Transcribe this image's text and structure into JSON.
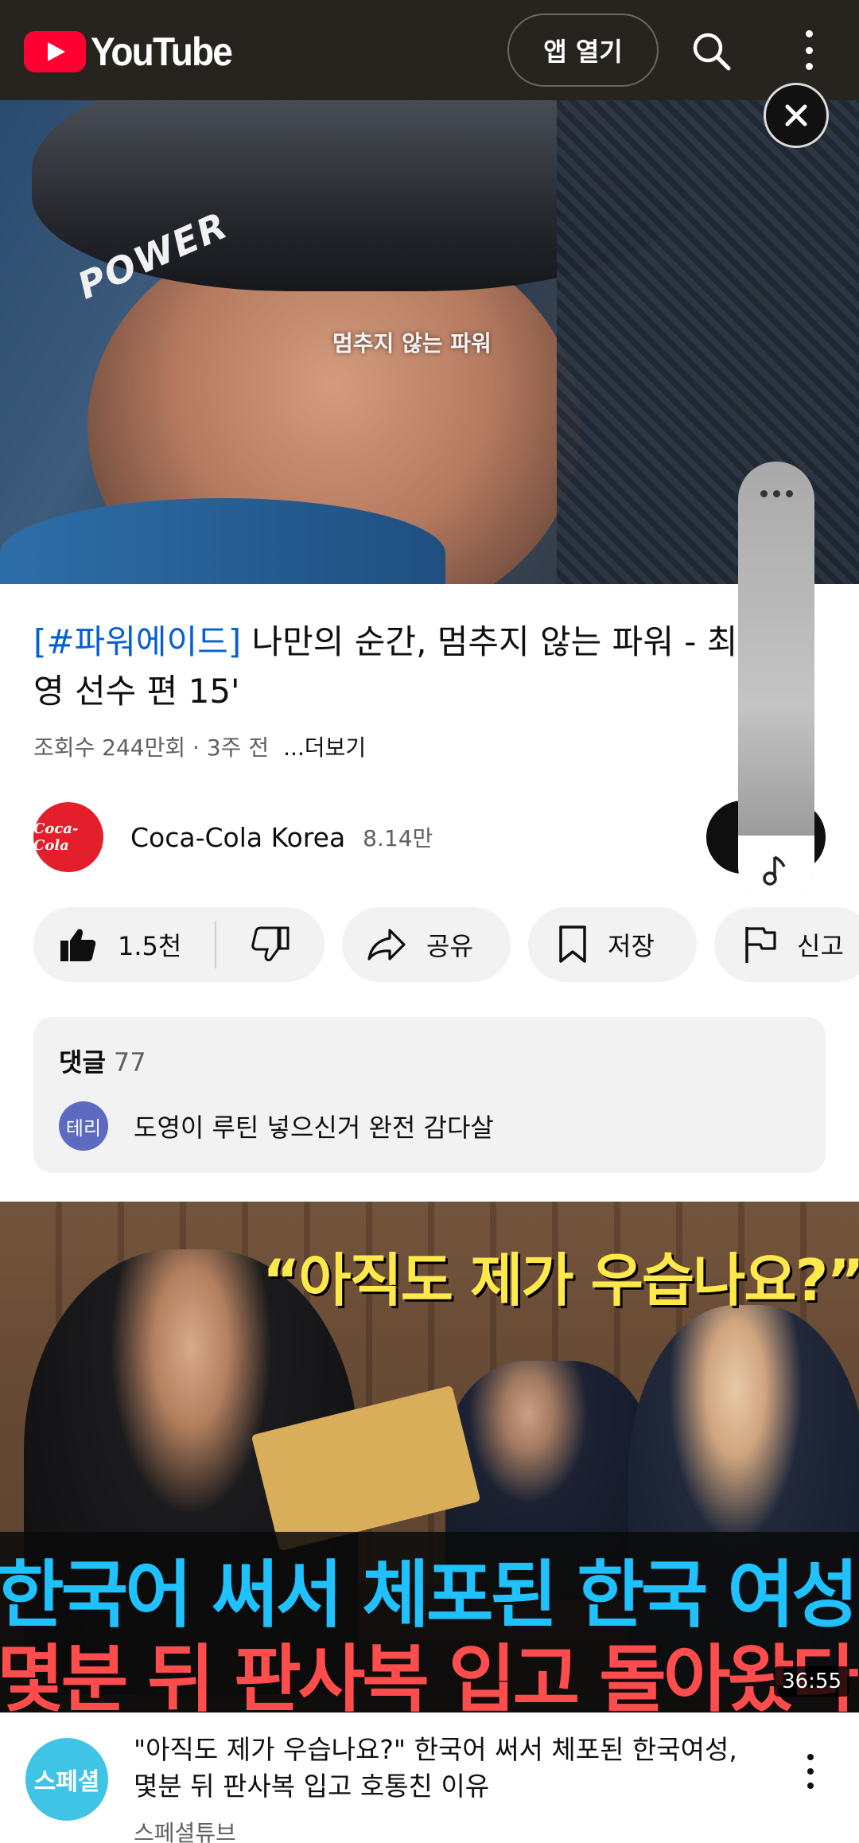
{
  "header": {
    "logo_text": "YouTube",
    "open_app_label": "앱 열기",
    "search_icon": "search-icon",
    "more_icon": "more-vert-icon",
    "background_color": "#272420"
  },
  "player": {
    "overlay_text": "POWER",
    "caption": "멈추지 않는 파워",
    "close_icon": "close-icon"
  },
  "video": {
    "title_tag": "[#파워에이드]",
    "title_rest": " 나만의 순간, 멈추지 않는 파워 - 최",
    "title_line2": "영 선수 편 15'",
    "views": "조회수 244만회",
    "age": "3주 전",
    "more_label": "...더보기"
  },
  "channel": {
    "avatar_text": "Coca-Cola",
    "name": "Coca-Cola Korea",
    "subscribers": "8.14만",
    "brand_color": "#e41e2b"
  },
  "actions": {
    "like_count": "1.5천",
    "share_label": "공유",
    "save_label": "저장",
    "report_label": "신고"
  },
  "comments": {
    "header_label": "댓글",
    "count": "77",
    "top_comment_avatar": "테리",
    "top_comment_text": "도영이 루틴 넣으신거 완전 감다살"
  },
  "next_video": {
    "thumb_quote": "“아직도 제가 우습나요?”",
    "thumb_line1": "한국어 써서 체포된 한국 여성",
    "thumb_line2": "몇분 뒤 판사복 입고 돌아왔다",
    "duration": "36:55",
    "channel_avatar_text": "스페셜",
    "title": "\"아직도 제가 우습나요?\" 한국어 써서 체포된 한국여성, 몇분 뒤 판사복 입고 호통친 이유",
    "channel": "스페셜튜브"
  },
  "side_panel": {
    "more_icon": "more-horiz-icon",
    "music_icon": "music-note-icon"
  }
}
